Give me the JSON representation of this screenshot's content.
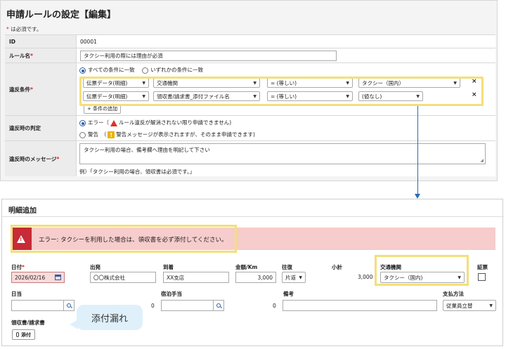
{
  "rule_settings": {
    "title": "申請ルールの設定【編集】",
    "required_star": "*",
    "required_note": "は必須です。",
    "fields": {
      "id": {
        "label": "ID",
        "value": "00001"
      },
      "rule_name": {
        "label": "ルール名",
        "star": "*",
        "value": "タクシー利用の際には理由が必須"
      },
      "violation_conditions": {
        "label": "違反条件",
        "star": "*",
        "match_all": "すべての条件に一致",
        "match_any": "いずれかの条件に一致",
        "rows": [
          {
            "field": "伝票データ(明細)",
            "item": "交通機関",
            "op": "= (等しい)",
            "value": "タクシー（国内）",
            "remove": "×"
          },
          {
            "field": "伝票データ(明細)",
            "item": "領収書/請求書_添付ファイル名",
            "op": "= (等しい)",
            "value": "(値なし)",
            "remove": "×"
          }
        ],
        "add_condition": "+ 条件の追加"
      },
      "judgment": {
        "label": "違反時の判定",
        "error_option": "エラー（",
        "error_desc": "ルール違反が解消されない限り申請できません)",
        "warning_option": "警告　（",
        "warning_mark": "!",
        "warning_desc": "警告メッセージが表示されますが、そのまま申請できます)"
      },
      "message": {
        "label": "違反時のメッセージ",
        "star": "*",
        "value": "タクシー利用の場合、備考欄へ理由を明記して下さい",
        "example": "例）「タクシー利用の場合、領収書は必須です。」"
      }
    }
  },
  "line_item": {
    "title": "明細追加",
    "error_message": "エラー: タクシーを利用した場合は、領収書を必ず添付してください。",
    "labels": {
      "date": "日付",
      "date_star": "*",
      "departure": "出発",
      "arrival": "到着",
      "amount": "金額/Km",
      "round_trip": "往復",
      "subtotal": "小計",
      "transport": "交通機関",
      "evidence": "証票",
      "daily_allowance": "日当",
      "lodging_allowance": "宿泊手当",
      "remarks": "備考",
      "payment_method": "支払方法",
      "receipt": "領収書/請求書"
    },
    "values": {
      "date": "2026/02/16",
      "departure": "〇〇株式会社",
      "arrival": "XX支店",
      "amount": "3,000",
      "round_trip": "片道",
      "subtotal": "3,000",
      "transport": "タクシー（国内)",
      "daily_allowance_amount": "0",
      "lodging_allowance_amount": "0",
      "payment_method": "従業員立替"
    },
    "attach_button": "添付",
    "callout": "添付漏れ"
  },
  "colors": {
    "highlight": "#f3df7a",
    "error_bg": "#f6cccc",
    "error_icon": "#c62b37",
    "connector": "#2b6cb0"
  }
}
